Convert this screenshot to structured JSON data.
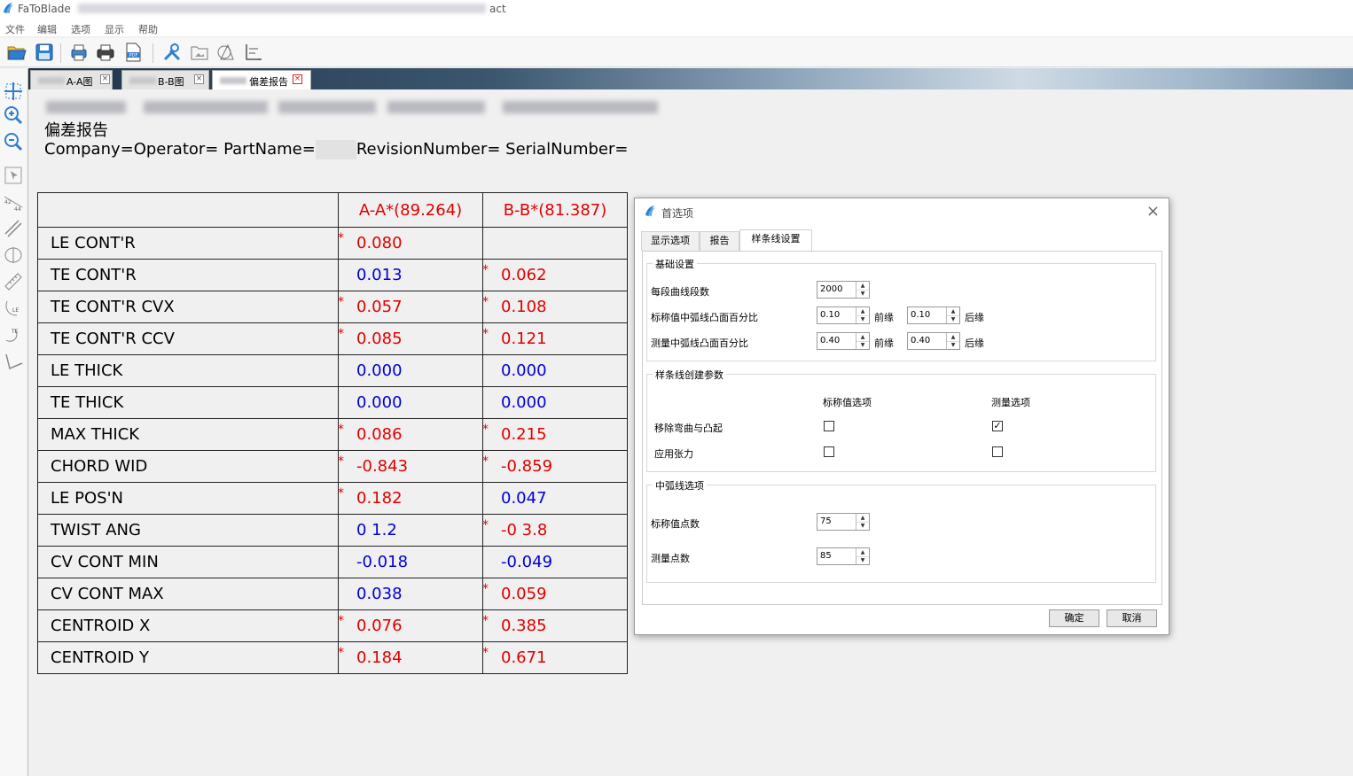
{
  "window": {
    "app_name": "FaToBlade",
    "title_suffix": "act"
  },
  "menu": [
    "文件",
    "编辑",
    "选项",
    "显示",
    "帮助"
  ],
  "tabs": [
    {
      "label": "A-A图"
    },
    {
      "label": "B-B图"
    },
    {
      "label": "偏差报告"
    }
  ],
  "report": {
    "title": "偏差报告",
    "info_left": "Company=Operator= PartName=",
    "info_right": "RevisionNumber= SerialNumber=",
    "columns": [
      "A-A*(89.264)",
      "B-B*(81.387)"
    ],
    "rows": [
      {
        "name": "LE CONT'R",
        "a": "0.080",
        "a_star": "*",
        "a_color": "red",
        "b": "",
        "b_star": "",
        "b_color": "blue"
      },
      {
        "name": "TE CONT'R",
        "a": "0.013",
        "a_star": "",
        "a_color": "blue",
        "b": "0.062",
        "b_star": "*",
        "b_color": "red"
      },
      {
        "name": "TE CONT'R CVX",
        "a": "0.057",
        "a_star": "*",
        "a_color": "red",
        "b": "0.108",
        "b_star": "*",
        "b_color": "red"
      },
      {
        "name": "TE CONT'R CCV",
        "a": "0.085",
        "a_star": "*",
        "a_color": "red",
        "b": "0.121",
        "b_star": "*",
        "b_color": "red"
      },
      {
        "name": "LE THICK",
        "a": "0.000",
        "a_star": "",
        "a_color": "blue",
        "b": "0.000",
        "b_star": "",
        "b_color": "blue"
      },
      {
        "name": "TE THICK",
        "a": "0.000",
        "a_star": "",
        "a_color": "blue",
        "b": "0.000",
        "b_star": "",
        "b_color": "blue"
      },
      {
        "name": "MAX THICK",
        "a": "0.086",
        "a_star": "*",
        "a_color": "red",
        "b": "0.215",
        "b_star": "*",
        "b_color": "red"
      },
      {
        "name": "CHORD WID",
        "a": "-0.843",
        "a_star": "*",
        "a_color": "red",
        "b": "-0.859",
        "b_star": "*",
        "b_color": "red"
      },
      {
        "name": "LE POS'N",
        "a": "0.182",
        "a_star": "*",
        "a_color": "red",
        "b": "0.047",
        "b_star": "",
        "b_color": "blue"
      },
      {
        "name": "TWIST ANG",
        "a": "0  1.2",
        "a_star": "",
        "a_color": "blue",
        "b": "-0  3.8",
        "b_star": "*",
        "b_color": "red"
      },
      {
        "name": "CV CONT MIN",
        "a": "-0.018",
        "a_star": "",
        "a_color": "blue",
        "b": "-0.049",
        "b_star": "",
        "b_color": "blue"
      },
      {
        "name": "CV CONT MAX",
        "a": "0.038",
        "a_star": "",
        "a_color": "blue",
        "b": "0.059",
        "b_star": "*",
        "b_color": "red"
      },
      {
        "name": "CENTROID X",
        "a": "0.076",
        "a_star": "*",
        "a_color": "red",
        "b": "0.385",
        "b_star": "*",
        "b_color": "red"
      },
      {
        "name": "CENTROID Y",
        "a": "0.184",
        "a_star": "*",
        "a_color": "red",
        "b": "0.671",
        "b_star": "*",
        "b_color": "red"
      }
    ]
  },
  "dialog": {
    "title": "首选项",
    "tabs": [
      "显示选项",
      "报告",
      "样条线设置"
    ],
    "basic": {
      "title": "基础设置",
      "segments_label": "每段曲线段数",
      "segments_value": "2000",
      "nominal_label": "标称值中弧线凸面百分比",
      "nominal_le_value": "0.10",
      "nominal_te_value": "0.10",
      "measured_label": "测量中弧线凸面百分比",
      "measured_le_value": "0.40",
      "measured_te_value": "0.40",
      "le_label": "前缘",
      "te_label": "后缘"
    },
    "spline": {
      "title": "样条线创建参数",
      "col_nominal": "标称值选项",
      "col_measured": "测量选项",
      "remove_label": "移除弯曲与凸起",
      "remove_nominal": false,
      "remove_measured": true,
      "tension_label": "应用张力",
      "tension_nominal": false,
      "tension_measured": false
    },
    "camber": {
      "title": "中弧线选项",
      "nominal_points_label": "标称值点数",
      "nominal_points_value": "75",
      "measured_points_label": "测量点数",
      "measured_points_value": "85"
    },
    "ok_label": "确定",
    "cancel_label": "取消"
  }
}
